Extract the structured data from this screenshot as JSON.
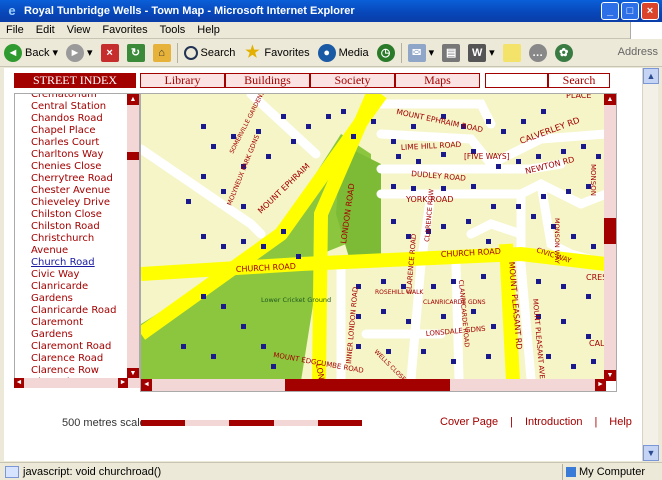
{
  "window": {
    "title": "Royal Tunbridge Wells - Town Map - Microsoft Internet Explorer",
    "icon": "ie-icon"
  },
  "menu": [
    "File",
    "Edit",
    "View",
    "Favorites",
    "Tools",
    "Help"
  ],
  "toolbar": {
    "back": "Back",
    "search": "Search",
    "favorites": "Favorites",
    "media": "Media",
    "address": "Address"
  },
  "street_index": {
    "heading": "STREET INDEX",
    "items": [
      "Crematorium",
      "Central Station",
      "Chandos Road",
      "Chapel Place",
      "Charles Court",
      "Charltons Way",
      "Chenies Close",
      "Cherrytree Road",
      "Chester Avenue",
      "Chieveley Drive",
      "Chilston Close",
      "Chilston Road",
      "Christchurch Avenue",
      "Church Road",
      "Civic Way",
      "Clanricarde Gardens",
      "Clanricarde Road",
      "Claremont Gardens",
      "Claremont Road",
      "Clarence Road",
      "Clarence Row",
      "Clarendon"
    ],
    "active_index": 13
  },
  "nav_tabs": [
    "Library",
    "Buildings",
    "Society",
    "Maps"
  ],
  "search": {
    "button": "Search",
    "value": ""
  },
  "map": {
    "labels": [
      {
        "text": "MOUNT EPHRAIM ROAD"
      },
      {
        "text": "LIME HILL ROAD"
      },
      {
        "text": "[FIVE WAYS]"
      },
      {
        "text": "CALVERLEY RD"
      },
      {
        "text": "NEWTON RD"
      },
      {
        "text": "DUDLEY ROAD"
      },
      {
        "text": "YORK ROAD"
      },
      {
        "text": "CHURCH ROAD"
      },
      {
        "text": "CHURCH ROAD"
      },
      {
        "text": "MOUNT EPHRAIM"
      },
      {
        "text": "LONDON ROAD"
      },
      {
        "text": "SOMERVILLE GARDENS"
      },
      {
        "text": "MOLYNEUX PARK GDNS"
      },
      {
        "text": "CLARENCE ROW"
      },
      {
        "text": "CIVIC WAY"
      },
      {
        "text": "MONSON WAY"
      },
      {
        "text": "MONSON"
      },
      {
        "text": "CRESC"
      },
      {
        "text": "MOUNT PLEASANT RD"
      },
      {
        "text": "MOUNT PLEASANT AVENUE"
      },
      {
        "text": "CLANRICARDE ROAD"
      },
      {
        "text": "CLARENCE ROAD"
      },
      {
        "text": "INNER LONDON ROAD"
      },
      {
        "text": "ROSEHILL WALK"
      },
      {
        "text": "CLANRICARDE GDNS"
      },
      {
        "text": "LONSDALE GDNS"
      },
      {
        "text": "WELLS CLOSE"
      },
      {
        "text": "MOUNT EDGCUMBE ROAD"
      },
      {
        "text": "Lower Cricket Ground"
      },
      {
        "text": "PLACE"
      },
      {
        "text": "CAL"
      },
      {
        "text": "LOND"
      }
    ]
  },
  "footer": {
    "scale_label": "500 metres scale",
    "links": [
      "Cover Page",
      "Introduction",
      "Help"
    ]
  },
  "status": {
    "text": "javascript: void churchroad()",
    "zone": "My Computer"
  },
  "colors": {
    "brand": "#a30000",
    "road_major": "#ffff00",
    "park": "#8cc63f",
    "map_bg": "#f5f5c8",
    "building": "#1a1a8c"
  }
}
